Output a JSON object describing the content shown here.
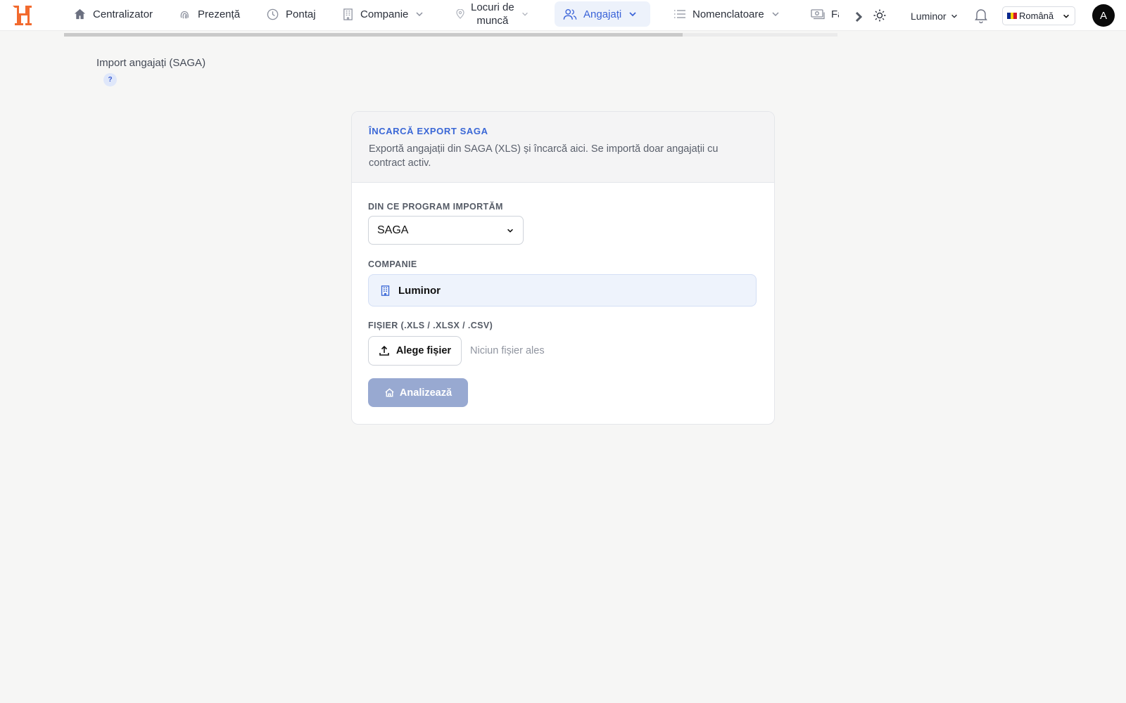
{
  "brand": {
    "logo_text": "H",
    "logo_color": "#f26a2e"
  },
  "nav": {
    "items": [
      {
        "label": "Centralizator",
        "icon": "home-icon"
      },
      {
        "label": "Prezență",
        "icon": "fingerprint-icon"
      },
      {
        "label": "Pontaj",
        "icon": "clock-icon"
      },
      {
        "label": "Companie",
        "icon": "building-icon"
      },
      {
        "label_line1": "Locuri de",
        "label_line2": "muncă",
        "icon": "map-pin-icon"
      },
      {
        "label": "Angajați",
        "icon": "users-icon",
        "active": true
      },
      {
        "label": "Nomenclatoare",
        "icon": "list-icon"
      },
      {
        "label": "Fa",
        "icon": "money-icon"
      }
    ],
    "more_icon": "chevron-right-icon",
    "theme_icon": "sun-icon"
  },
  "header": {
    "company_switch": "Luminor",
    "notifications_icon": "bell-icon",
    "language": "Română",
    "avatar_initial": "A"
  },
  "progress": {
    "fraction": 0.8
  },
  "page": {
    "title": "Import angajați (SAGA)",
    "help_badge": "?"
  },
  "card": {
    "title": "ÎNCARCĂ EXPORT SAGA",
    "description": "Exportă angajații din SAGA (XLS) și încarcă aici. Se importă doar angajații cu contract activ.",
    "program_label": "DIN CE PROGRAM IMPORTĂM",
    "program_value": "SAGA",
    "company_label": "COMPANIE",
    "company_value": "Luminor",
    "file_label": "FIȘIER (.XLS / .XLSX / .CSV)",
    "file_button": "Alege fișier",
    "file_status": "Niciun fișier ales",
    "analyze_button": "Analizează"
  },
  "colors": {
    "accent": "#3a67d6",
    "active_nav_bg": "#edf2fb",
    "analyze_disabled": "#98a9d1"
  }
}
